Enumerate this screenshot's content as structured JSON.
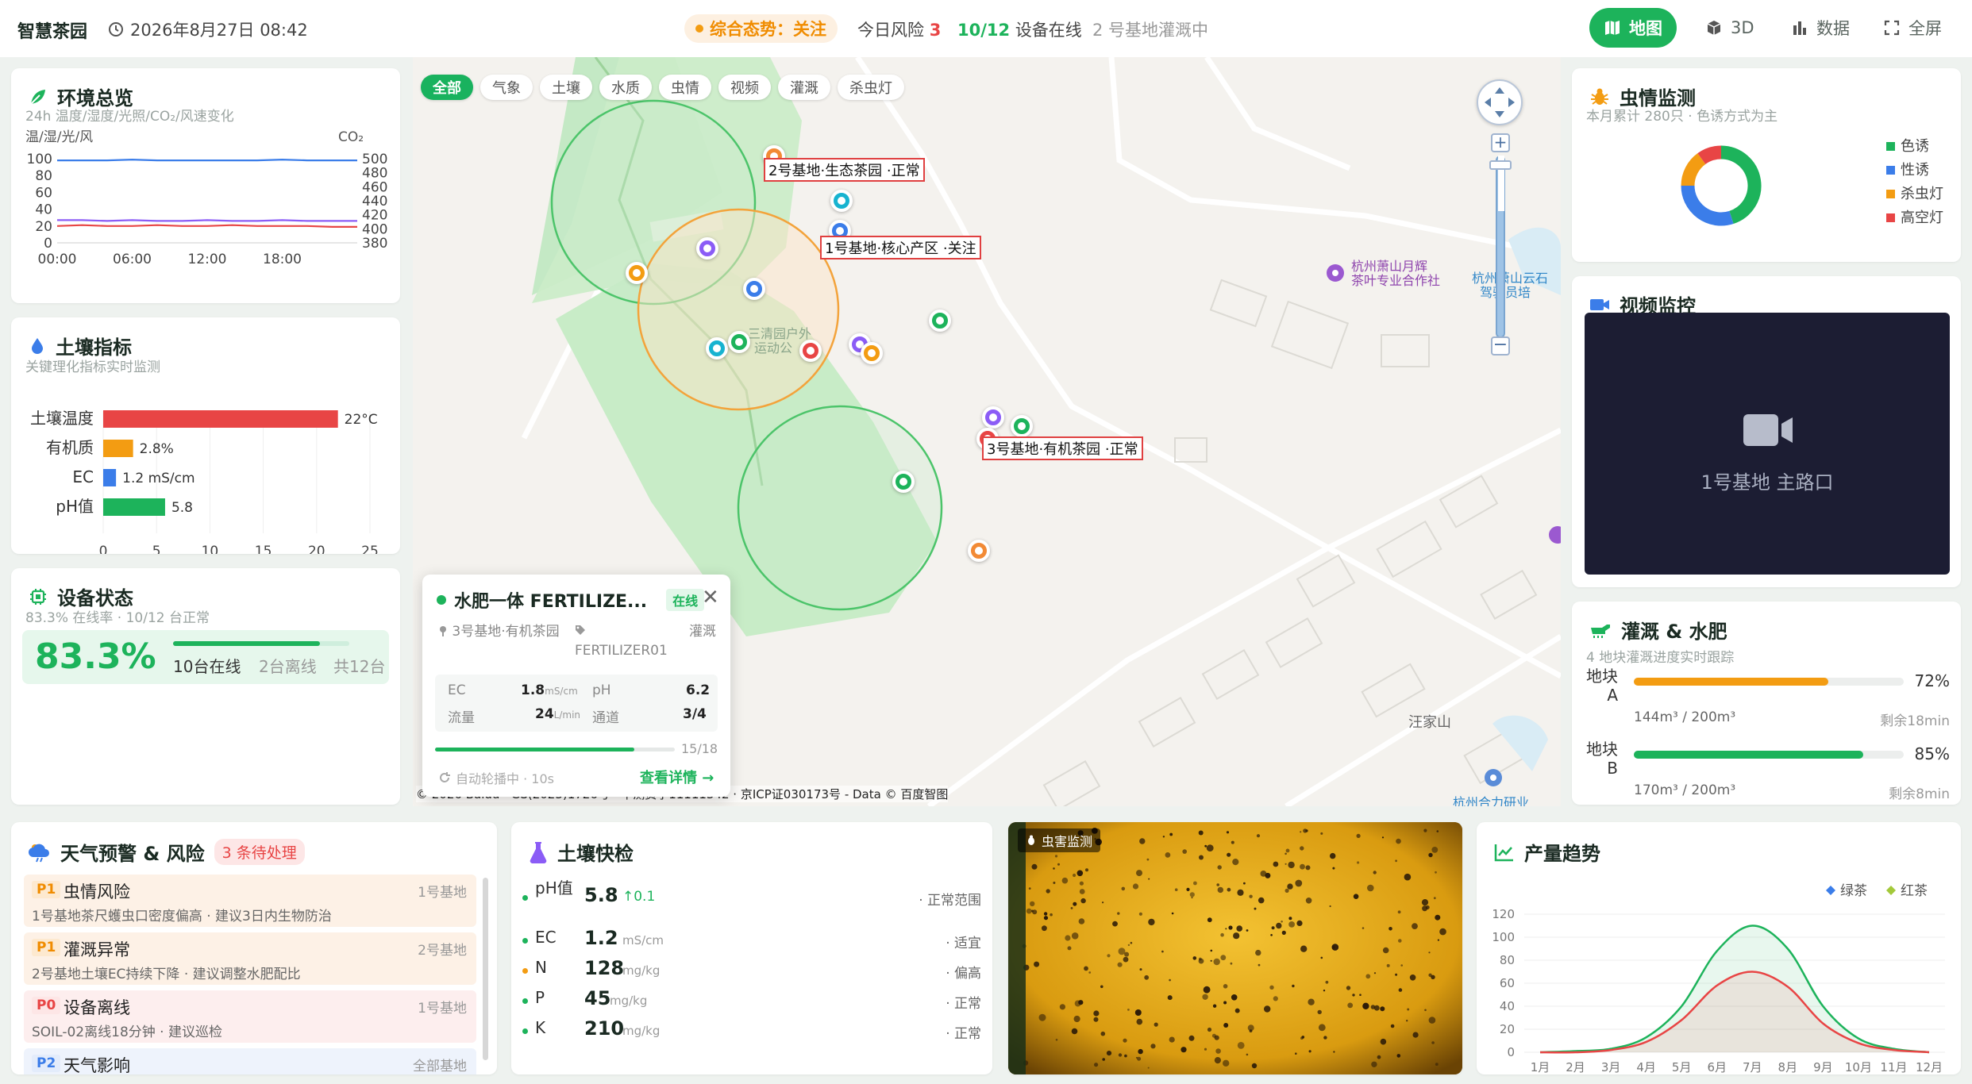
{
  "header": {
    "app_title": "智慧茶园",
    "datetime": "2026年8月27日 08:42",
    "status_label": "综合态势：关注",
    "risk_label": "今日风险",
    "risk_count": "3",
    "online_count": "10/12",
    "online_label": "设备在线",
    "irrigation_status": "2 号基地灌溉中",
    "nav": {
      "map": "地图",
      "3d": "3D",
      "data": "数据",
      "fullscreen": "全屏"
    }
  },
  "env": {
    "title": "环境总览",
    "subtitle": "24h 温度/湿度/光照/CO₂/风速变化",
    "left_axis_label": "温/湿/光/风",
    "right_axis_label": "CO₂",
    "left_ticks": [
      "100",
      "80",
      "60",
      "40",
      "20",
      "0"
    ],
    "right_ticks": [
      "500",
      "480",
      "460",
      "440",
      "420",
      "400",
      "380"
    ],
    "x_ticks": [
      "00:00",
      "06:00",
      "12:00",
      "18:00"
    ]
  },
  "soil": {
    "title": "土壤指标",
    "subtitle": "关键理化指标实时监测",
    "x_ticks": [
      "0",
      "5",
      "10",
      "15",
      "20",
      "25"
    ]
  },
  "device": {
    "title": "设备状态",
    "subtitle": "83.3% 在线率 · 10/12 台正常",
    "rate": "83.3%",
    "rate_value": 83.3,
    "online": "10台在线",
    "offline": "2台离线",
    "total": "共12台"
  },
  "map": {
    "filters": [
      "全部",
      "气象",
      "土壤",
      "水质",
      "虫情",
      "视频",
      "灌溉",
      "杀虫灯"
    ],
    "labels": {
      "base2": "2号基地·生态茶园 ·正常",
      "base1": "1号基地·核心产区 ·关注",
      "base3": "3号基地·有机茶园 ·正常"
    },
    "poi": {
      "coop1": "杭州萧山月辉",
      "coop2": "茶叶专业合作社",
      "school1": "杭州萧山云石",
      "school2": "驾驶员培",
      "park1": "三清园户外",
      "park2": "运动公",
      "hill": "汪家山",
      "bottom": "杭州合力研业"
    },
    "copyright": "© 2026 Baidu · GS(2023)1726号 · 甲测资字11111342 · 京ICP证030173号 - Data © 百度智图"
  },
  "popup": {
    "title": "水肥一体 FERTILIZE...",
    "badge": "在线",
    "location": "3号基地·有机茶园",
    "device_id": "FERTILIZER01",
    "type": "灌溉",
    "ec_label": "EC",
    "ec_value": "1.8",
    "ec_unit": "mS/cm",
    "ph_label": "pH",
    "ph_value": "6.2",
    "flow_label": "流量",
    "flow_value": "24",
    "flow_unit": "L/min",
    "channel_label": "通道",
    "channel_value": "3/4",
    "progress_text": "15/18",
    "progress_value": 0.83,
    "auto_text": "自动轮播中 · 10s",
    "detail_link": "查看详情 →"
  },
  "pest": {
    "title": "虫情监测",
    "subtitle": "本月累计 280只 · 色诱方式为主"
  },
  "video": {
    "title": "视频监控",
    "camera_label": "1号基地 主路口"
  },
  "irrigation": {
    "title": "灌溉 & 水肥",
    "subtitle": "4 地块灌溉进度实时跟踪"
  },
  "warning": {
    "title": "天气预警 & 风险",
    "badge": "3 条待处理"
  },
  "quick": {
    "title": "土壤快检"
  },
  "camera": {
    "label": "虫害监测"
  },
  "yield": {
    "title": "产量趋势",
    "y_ticks": [
      "120",
      "100",
      "80",
      "60",
      "40",
      "20",
      "0"
    ]
  },
  "colors": {
    "primary": "#1db35b",
    "warning": "#f39c12",
    "danger": "#e84545",
    "blue": "#3b7de9",
    "purple": "#8b5cf6",
    "cyan": "#17b3d0"
  },
  "chart_data": [
    {
      "type": "line",
      "name": "环境总览",
      "x": [
        "00:00",
        "02:00",
        "04:00",
        "06:00",
        "08:00",
        "10:00",
        "12:00",
        "14:00",
        "16:00",
        "18:00",
        "20:00",
        "22:00",
        "24:00"
      ],
      "left_ylim": [
        0,
        100
      ],
      "right_ylim": [
        380,
        500
      ],
      "series": [
        {
          "axis": "left",
          "color": "#3b7de9",
          "values": [
            98,
            98,
            98,
            99,
            98,
            98,
            98,
            98,
            98,
            99,
            98,
            98,
            98
          ]
        },
        {
          "axis": "left",
          "color": "#8b5cf6",
          "values": [
            27,
            27,
            26,
            27,
            26,
            26,
            27,
            26,
            26,
            27,
            26,
            26,
            26
          ]
        },
        {
          "axis": "left",
          "color": "#e84545",
          "values": [
            20,
            21,
            20,
            20,
            21,
            20,
            20,
            21,
            20,
            20,
            20,
            19,
            19
          ]
        }
      ]
    },
    {
      "type": "bar",
      "name": "土壤指标",
      "orientation": "horizontal",
      "xlim": [
        0,
        25
      ],
      "items": [
        {
          "label": "土壤温度",
          "value": 22,
          "value_text": "22°C",
          "color": "#e84545"
        },
        {
          "label": "有机质",
          "value": 2.8,
          "value_text": "2.8%",
          "color": "#f39c12"
        },
        {
          "label": "EC",
          "value": 1.2,
          "value_text": "1.2 mS/cm",
          "color": "#3b7de9"
        },
        {
          "label": "pH值",
          "value": 5.8,
          "value_text": "5.8",
          "color": "#1db35b"
        }
      ]
    },
    {
      "type": "pie",
      "name": "虫情监测",
      "donut": true,
      "slices": [
        {
          "label": "色诱",
          "value": 45,
          "color": "#1db35b"
        },
        {
          "label": "性诱",
          "value": 30,
          "color": "#3b7de9"
        },
        {
          "label": "杀虫灯",
          "value": 15,
          "color": "#f39c12"
        },
        {
          "label": "高空灯",
          "value": 10,
          "color": "#e84545"
        }
      ]
    },
    {
      "type": "bar",
      "name": "灌溉 & 水肥",
      "items": [
        {
          "label": "地块 A",
          "percent": 72,
          "percent_text": "72%",
          "color": "#f39c12",
          "volume": "144m³ / 200m³",
          "remaining": "剩余18min"
        },
        {
          "label": "地块 B",
          "percent": 85,
          "percent_text": "85%",
          "color": "#1db35b",
          "volume": "170m³ / 200m³",
          "remaining": "剩余8min"
        }
      ]
    },
    {
      "type": "table",
      "name": "天气预警 & 风险",
      "rows": [
        {
          "level": "P1",
          "title": "虫情风险",
          "base": "1号基地",
          "detail": "1号基地茶尺蠖虫口密度偏高 · 建议3日内生物防治"
        },
        {
          "level": "P1",
          "title": "灌溉异常",
          "base": "2号基地",
          "detail": "2号基地土壤EC持续下降 · 建议调整水肥配比"
        },
        {
          "level": "P0",
          "title": "设备离线",
          "base": "1号基地",
          "detail": "SOIL-02离线18分钟 · 建议巡检"
        },
        {
          "level": "P2",
          "title": "天气影响",
          "base": "全部基地",
          "detail": ""
        }
      ]
    },
    {
      "type": "table",
      "name": "土壤快检",
      "rows": [
        {
          "key": "pH值",
          "value": "5.8",
          "unit": "",
          "delta": "↑0.1",
          "status": "· 正常范围",
          "color": "#1db35b"
        },
        {
          "key": "EC",
          "value": "1.2",
          "unit": "mS/cm",
          "delta": "",
          "status": "· 适宜",
          "color": "#1db35b"
        },
        {
          "key": "N",
          "value": "128",
          "unit": "mg/kg",
          "delta": "",
          "status": "· 偏高",
          "color": "#f39c12"
        },
        {
          "key": "P",
          "value": "45",
          "unit": "mg/kg",
          "delta": "",
          "status": "· 正常",
          "color": "#1db35b"
        },
        {
          "key": "K",
          "value": "210",
          "unit": "mg/kg",
          "delta": "",
          "status": "· 正常",
          "color": "#1db35b"
        }
      ]
    },
    {
      "type": "area",
      "name": "产量趋势",
      "categories": [
        "1月",
        "2月",
        "3月",
        "4月",
        "5月",
        "6月",
        "7月",
        "8月",
        "9月",
        "10月",
        "11月",
        "12月"
      ],
      "ylim": [
        0,
        120
      ],
      "series": [
        {
          "name": "绿茶",
          "color": "#1db35b",
          "values": [
            0,
            1,
            3,
            13,
            40,
            88,
            110,
            90,
            40,
            12,
            3,
            0
          ]
        },
        {
          "name": "红茶",
          "color": "#e84545",
          "values": [
            0,
            0,
            2,
            9,
            28,
            58,
            70,
            57,
            25,
            8,
            2,
            0
          ]
        }
      ]
    }
  ]
}
